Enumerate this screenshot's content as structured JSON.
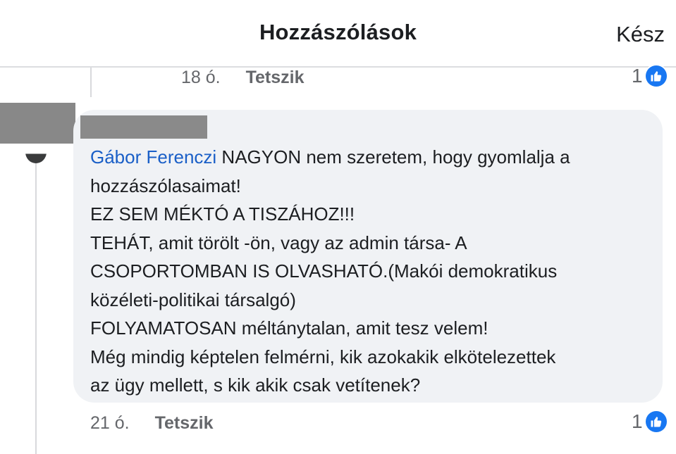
{
  "header": {
    "title": "Hozzászólások",
    "done_label": "Kész"
  },
  "previous_comment": {
    "time": "18 ó.",
    "like_label": "Tetszik",
    "reaction_count": "1"
  },
  "comment": {
    "mention": "Gábor Ferenczi",
    "text": " NAGYON nem szeretem, hogy gyomlalja a\nhozzászólasaimat!\nEZ SEM MÉKTÓ A TISZÁHOZ!!!\nTEHÁT, amit törölt -ön, vagy az admin társa- A\nCSOPORTOMBAN IS OLVASHATÓ.(Makói demokratikus\nközéleti-politikai társalgó)\nFOLYAMATOSAN méltánytalan, amit tesz velem!\nMég mindig képtelen felmérni, kik azokakik elkötelezettek\naz ügy mellett, s kik akik csak vetítenek?",
    "time": "21 ó.",
    "like_label": "Tetszik",
    "reaction_count": "1"
  },
  "colors": {
    "like_blue": "#1877f2",
    "mention_blue": "#1a5fc7",
    "bubble_bg": "#f0f2f5",
    "secondary_text": "#65676b"
  },
  "icons": {
    "reaction": "thumbs-up-icon"
  }
}
